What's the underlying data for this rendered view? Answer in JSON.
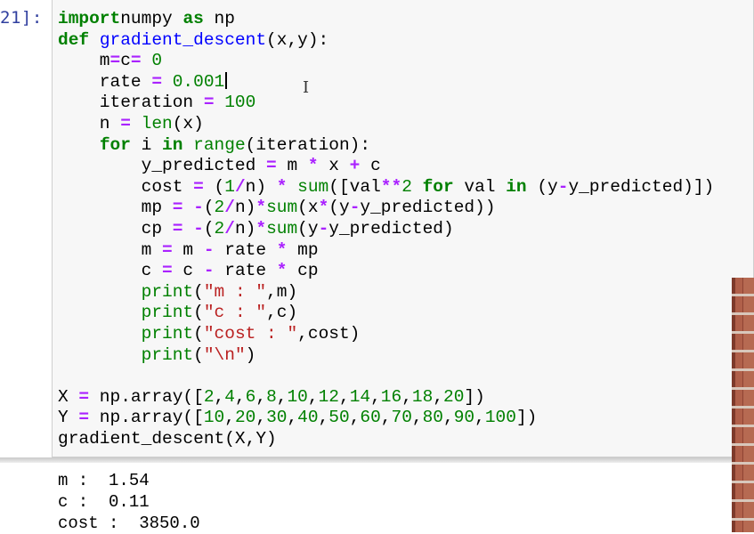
{
  "cell": {
    "prompt": "21]:",
    "cursor_line": 3,
    "lines": [
      [
        [
          "kw",
          "import"
        ],
        [
          "",
          "numpy "
        ],
        [
          "kw",
          "as"
        ],
        [
          "",
          " np"
        ]
      ],
      [
        [
          "kw",
          "def"
        ],
        [
          "",
          " "
        ],
        [
          "fn",
          "gradient_descent"
        ],
        [
          "",
          "(x,y):"
        ]
      ],
      [
        [
          "",
          "    m"
        ],
        [
          "op",
          "="
        ],
        [
          "",
          "c"
        ],
        [
          "op",
          "="
        ],
        [
          "",
          " "
        ],
        [
          "num",
          "0"
        ]
      ],
      [
        [
          "",
          "    rate "
        ],
        [
          "op",
          "="
        ],
        [
          "",
          " "
        ],
        [
          "num",
          "0.001"
        ]
      ],
      [
        [
          "",
          "    iteration "
        ],
        [
          "op",
          "="
        ],
        [
          "",
          " "
        ],
        [
          "num",
          "100"
        ]
      ],
      [
        [
          "",
          "    n "
        ],
        [
          "op",
          "="
        ],
        [
          "",
          " "
        ],
        [
          "bi",
          "len"
        ],
        [
          "",
          "(x)"
        ]
      ],
      [
        [
          "",
          "    "
        ],
        [
          "kw",
          "for"
        ],
        [
          "",
          " i "
        ],
        [
          "kw",
          "in"
        ],
        [
          "",
          " "
        ],
        [
          "bi",
          "range"
        ],
        [
          "",
          "(iteration):"
        ]
      ],
      [
        [
          "",
          "        y_predicted "
        ],
        [
          "op",
          "="
        ],
        [
          "",
          " m "
        ],
        [
          "op",
          "*"
        ],
        [
          "",
          " x "
        ],
        [
          "op",
          "+"
        ],
        [
          "",
          " c"
        ]
      ],
      [
        [
          "",
          "        cost "
        ],
        [
          "op",
          "="
        ],
        [
          "",
          " ("
        ],
        [
          "num",
          "1"
        ],
        [
          "op",
          "/"
        ],
        [
          "",
          "n) "
        ],
        [
          "op",
          "*"
        ],
        [
          "",
          " "
        ],
        [
          "bi",
          "sum"
        ],
        [
          "",
          "([val"
        ],
        [
          "op",
          "**"
        ],
        [
          "num",
          "2"
        ],
        [
          "",
          " "
        ],
        [
          "kw",
          "for"
        ],
        [
          "",
          " val "
        ],
        [
          "kw",
          "in"
        ],
        [
          "",
          " (y"
        ],
        [
          "op",
          "-"
        ],
        [
          "",
          "y_predicted)])"
        ]
      ],
      [
        [
          "",
          "        mp "
        ],
        [
          "op",
          "="
        ],
        [
          "",
          " "
        ],
        [
          "op",
          "-"
        ],
        [
          "",
          "("
        ],
        [
          "num",
          "2"
        ],
        [
          "op",
          "/"
        ],
        [
          "",
          "n)"
        ],
        [
          "op",
          "*"
        ],
        [
          "bi",
          "sum"
        ],
        [
          "",
          "(x"
        ],
        [
          "op",
          "*"
        ],
        [
          "",
          "(y"
        ],
        [
          "op",
          "-"
        ],
        [
          "",
          "y_predicted))"
        ]
      ],
      [
        [
          "",
          "        cp "
        ],
        [
          "op",
          "="
        ],
        [
          "",
          " "
        ],
        [
          "op",
          "-"
        ],
        [
          "",
          "("
        ],
        [
          "num",
          "2"
        ],
        [
          "op",
          "/"
        ],
        [
          "",
          "n)"
        ],
        [
          "op",
          "*"
        ],
        [
          "bi",
          "sum"
        ],
        [
          "",
          "(y"
        ],
        [
          "op",
          "-"
        ],
        [
          "",
          "y_predicted)"
        ]
      ],
      [
        [
          "",
          "        m "
        ],
        [
          "op",
          "="
        ],
        [
          "",
          " m "
        ],
        [
          "op",
          "-"
        ],
        [
          "",
          " rate "
        ],
        [
          "op",
          "*"
        ],
        [
          "",
          " mp"
        ]
      ],
      [
        [
          "",
          "        c "
        ],
        [
          "op",
          "="
        ],
        [
          "",
          " c "
        ],
        [
          "op",
          "-"
        ],
        [
          "",
          " rate "
        ],
        [
          "op",
          "*"
        ],
        [
          "",
          " cp"
        ]
      ],
      [
        [
          "",
          "        "
        ],
        [
          "bi",
          "print"
        ],
        [
          "",
          "("
        ],
        [
          "str",
          "\"m : \""
        ],
        [
          "",
          ",m)"
        ]
      ],
      [
        [
          "",
          "        "
        ],
        [
          "bi",
          "print"
        ],
        [
          "",
          "("
        ],
        [
          "str",
          "\"c : \""
        ],
        [
          "",
          ",c)"
        ]
      ],
      [
        [
          "",
          "        "
        ],
        [
          "bi",
          "print"
        ],
        [
          "",
          "("
        ],
        [
          "str",
          "\"cost : \""
        ],
        [
          "",
          ",cost)"
        ]
      ],
      [
        [
          "",
          "        "
        ],
        [
          "bi",
          "print"
        ],
        [
          "",
          "("
        ],
        [
          "str",
          "\"\\n\""
        ],
        [
          "",
          ")"
        ]
      ],
      [
        [
          "",
          ""
        ]
      ],
      [
        [
          "",
          "X "
        ],
        [
          "op",
          "="
        ],
        [
          "",
          " np.array(["
        ],
        [
          "num",
          "2"
        ],
        [
          "",
          ","
        ],
        [
          "num",
          "4"
        ],
        [
          "",
          ","
        ],
        [
          "num",
          "6"
        ],
        [
          "",
          ","
        ],
        [
          "num",
          "8"
        ],
        [
          "",
          ","
        ],
        [
          "num",
          "10"
        ],
        [
          "",
          ","
        ],
        [
          "num",
          "12"
        ],
        [
          "",
          ","
        ],
        [
          "num",
          "14"
        ],
        [
          "",
          ","
        ],
        [
          "num",
          "16"
        ],
        [
          "",
          ","
        ],
        [
          "num",
          "18"
        ],
        [
          "",
          ","
        ],
        [
          "num",
          "20"
        ],
        [
          "",
          "])"
        ]
      ],
      [
        [
          "",
          "Y "
        ],
        [
          "op",
          "="
        ],
        [
          "",
          " np.array(["
        ],
        [
          "num",
          "10"
        ],
        [
          "",
          ","
        ],
        [
          "num",
          "20"
        ],
        [
          "",
          ","
        ],
        [
          "num",
          "30"
        ],
        [
          "",
          ","
        ],
        [
          "num",
          "40"
        ],
        [
          "",
          ","
        ],
        [
          "num",
          "50"
        ],
        [
          "",
          ","
        ],
        [
          "num",
          "60"
        ],
        [
          "",
          ","
        ],
        [
          "num",
          "70"
        ],
        [
          "",
          ","
        ],
        [
          "num",
          "80"
        ],
        [
          "",
          ","
        ],
        [
          "num",
          "90"
        ],
        [
          "",
          ","
        ],
        [
          "num",
          "100"
        ],
        [
          "",
          "])"
        ]
      ],
      [
        [
          "",
          "gradient_descent(X,Y)"
        ]
      ]
    ]
  },
  "output": {
    "lines": [
      "m :  1.54",
      "c :  0.11",
      "cost :  3850.0"
    ]
  },
  "colors": {
    "keyword": "#008000",
    "function_name": "#0000ff",
    "operator": "#aa22ff",
    "number": "#008000",
    "string": "#ba2121",
    "prompt": "#303F9F",
    "cell_background": "#f7f7f7"
  },
  "icons": {
    "text_cursor": "i-beam-cursor-icon"
  }
}
